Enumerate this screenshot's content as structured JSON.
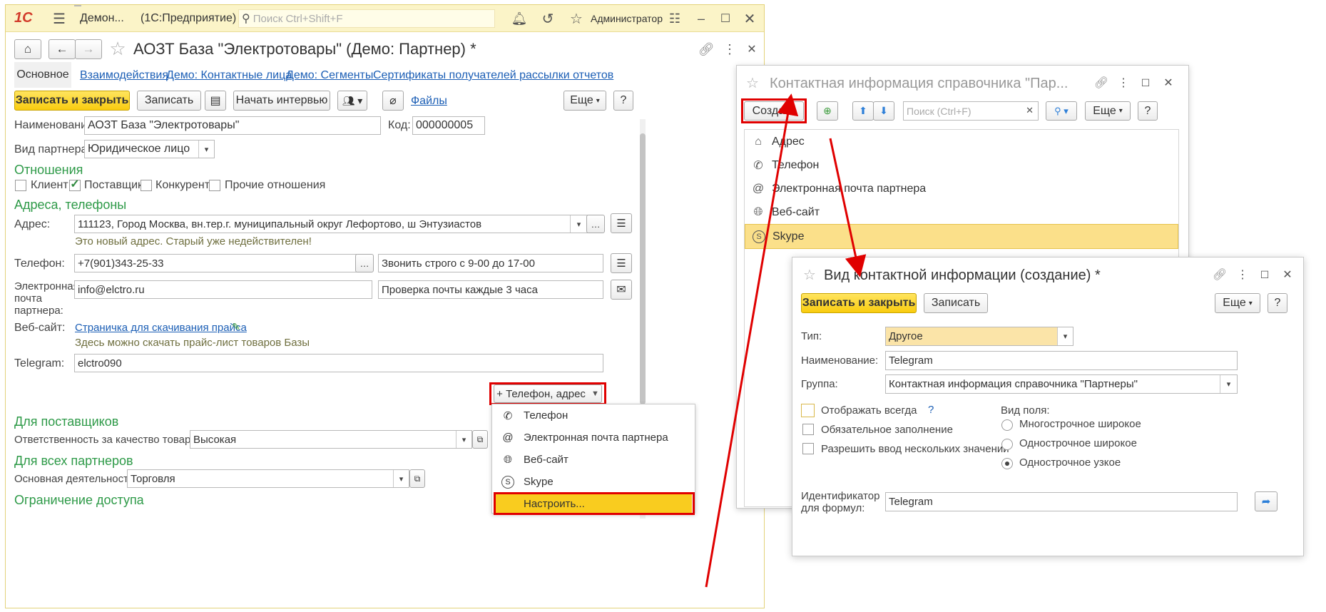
{
  "titlebar": {
    "logo": "1С",
    "app_title": "Демон...",
    "platform": "(1С:Предприятие)",
    "search_placeholder": "Поиск Ctrl+Shift+F",
    "user": "Администратор"
  },
  "main_form": {
    "title": "АОЗТ База \"Электротовары\" (Демо: Партнер) *",
    "tabs": [
      "Основное",
      "Взаимодействия",
      "Демо: Контактные лица",
      "Демо: Сегменты",
      "Сертификаты получателей рассылки отчетов"
    ],
    "toolbar": {
      "save_close": "Записать и закрыть",
      "save": "Записать",
      "start_interview": "Начать интервью",
      "files": "Файлы",
      "more": "Еще",
      "help": "?"
    },
    "name_label": "Наименование:",
    "name_value": "АОЗТ База \"Электротовары\"",
    "code_label": "Код:",
    "code_value": "000000005",
    "partner_type_label": "Вид партнера:",
    "partner_type_value": "Юридическое лицо",
    "relations_header": "Отношения",
    "relations": [
      {
        "label": "Клиент",
        "checked": false
      },
      {
        "label": "Поставщик",
        "checked": true
      },
      {
        "label": "Конкурент",
        "checked": false
      },
      {
        "label": "Прочие отношения",
        "checked": false
      }
    ],
    "addresses_header": "Адреса, телефоны",
    "address_label": "Адрес:",
    "address_value": "111123, Город Москва, вн.тер.г. муниципальный округ Лефортово, ш Энтузиастов",
    "address_hint": "Это новый адрес. Старый уже недействителен!",
    "phone_label": "Телефон:",
    "phone_value": "+7(901)343-25-33",
    "phone_comment": "Звонить строго с 9-00 до 17-00",
    "email_label_1": "Электронная",
    "email_label_2": "почта",
    "email_label_3": "партнера:",
    "email_value": "info@elctro.ru",
    "email_comment": "Проверка почты каждые 3 часа",
    "website_label": "Веб-сайт:",
    "website_link": "Страничка для скачивания прайса",
    "website_hint": "Здесь можно скачать прайс-лист товаров Базы",
    "telegram_label": "Telegram:",
    "telegram_value": "elctro090",
    "add_contact_button": "+ Телефон, адрес",
    "suppliers_header": "Для поставщиков",
    "quality_label": "Ответственность за качество товаров:",
    "quality_value": "Высокая",
    "all_partners_header": "Для всех партнеров",
    "activity_label": "Основная деятельность:",
    "activity_value": "Торговля",
    "access_header": "Ограничение доступа"
  },
  "add_menu": {
    "items": [
      {
        "icon": "phone-icon",
        "label": "Телефон"
      },
      {
        "icon": "at-icon",
        "label": "Электронная почта партнера"
      },
      {
        "icon": "globe-icon",
        "label": "Веб-сайт"
      },
      {
        "icon": "skype-icon",
        "label": "Skype"
      }
    ],
    "configure": "Настроить..."
  },
  "contact_list_window": {
    "title": "Контактная информация справочника \"Пар...",
    "create_button": "Создать",
    "search_placeholder": "Поиск (Ctrl+F)",
    "more": "Еще",
    "help": "?",
    "items": [
      {
        "icon": "house-icon",
        "label": "Адрес"
      },
      {
        "icon": "phone-icon",
        "label": "Телефон"
      },
      {
        "icon": "at-icon",
        "label": "Электронная почта партнера"
      },
      {
        "icon": "globe-icon",
        "label": "Веб-сайт"
      },
      {
        "icon": "skype-icon",
        "label": "Skype"
      }
    ]
  },
  "kind_window": {
    "title": "Вид контактной информации (создание) *",
    "save_close": "Записать и закрыть",
    "save": "Записать",
    "more": "Еще",
    "help": "?",
    "type_label": "Тип:",
    "type_value": "Другое",
    "name_label": "Наименование:",
    "name_value": "Telegram",
    "group_label": "Группа:",
    "group_value": "Контактная информация справочника \"Партнеры\"",
    "checkboxes": [
      {
        "label": "Отображать всегда",
        "checked": false
      },
      {
        "label": "Обязательное заполнение",
        "checked": false
      },
      {
        "label": "Разрешить ввод нескольких значений",
        "checked": false
      }
    ],
    "help_mark": "?",
    "field_kind_label": "Вид поля:",
    "field_kinds": [
      {
        "label": "Многострочное широкое",
        "selected": false
      },
      {
        "label": "Однострочное широкое",
        "selected": false
      },
      {
        "label": "Однострочное узкое",
        "selected": true
      }
    ],
    "id_label_1": "Идентификатор",
    "id_label_2": "для формул:",
    "id_value": "Telegram"
  },
  "colors": {
    "accent_yellow": "#f9cc0f",
    "section_green": "#2e9a48",
    "link_blue": "#1b5eb5",
    "highlight_red": "#e00000",
    "selected_row": "#fbe08a"
  }
}
